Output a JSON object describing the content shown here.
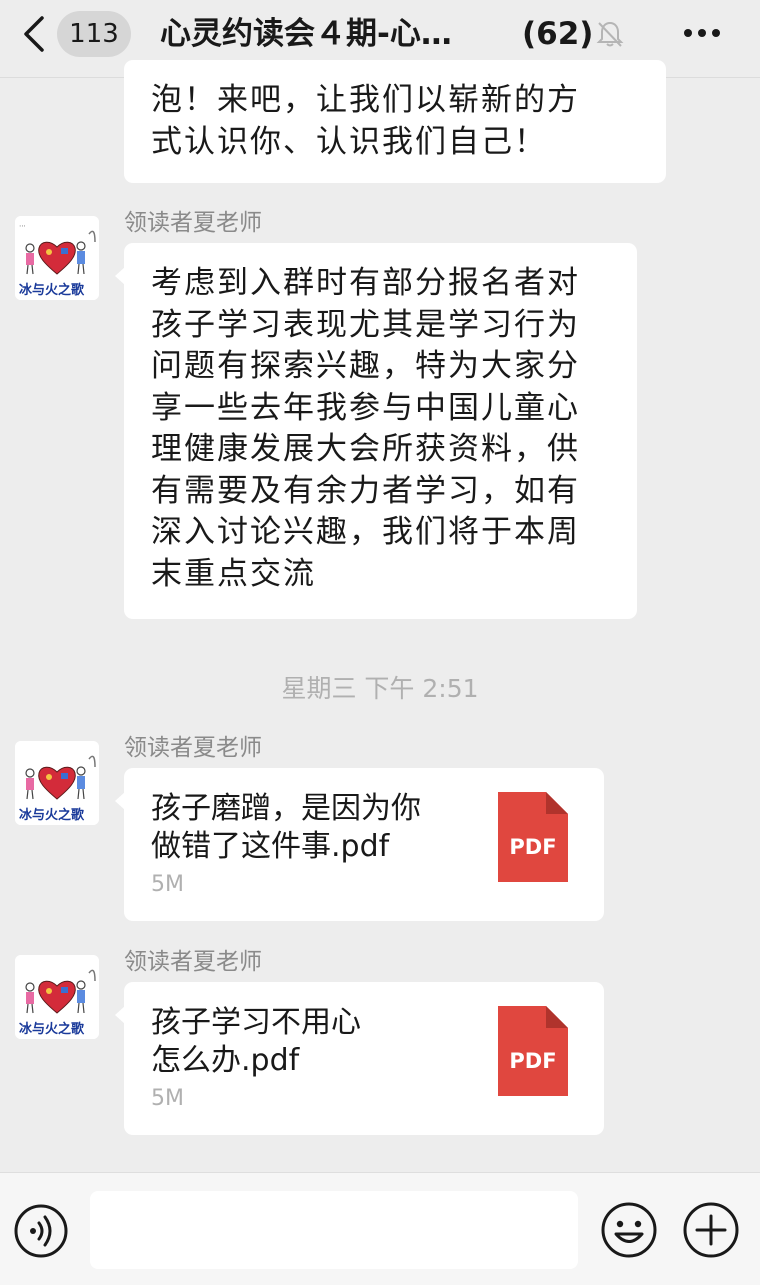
{
  "header": {
    "unread_count": "113",
    "title": "心灵约读会４期-心…",
    "member_count": "(62)"
  },
  "messages": [
    {
      "text": "泡！来吧，让我们以崭新的方\n式认识你、认识我们自己！"
    },
    {
      "sender": "领读者夏老师",
      "text": "考虑到入群时有部分报名者对\n孩子学习表现尤其是学习行为\n问题有探索兴趣，特为大家分\n享一些去年我参与中国儿童心\n理健康发展大会所获资料，供\n有需要及有余力者学习，如有\n深入讨论兴趣，我们将于本周\n末重点交流"
    }
  ],
  "timestamp": "星期三 下午 2:51",
  "files": [
    {
      "sender": "领读者夏老师",
      "name": "孩子磨蹭，是因为你\n做错了这件事.pdf",
      "size": "5M",
      "icon_label": "PDF"
    },
    {
      "sender": "领读者夏老师",
      "name": "孩子学习不用心\n怎么办.pdf",
      "size": "5M",
      "icon_label": "PDF"
    }
  ],
  "avatar": {
    "caption": "冰与火之歌"
  },
  "colors": {
    "background": "#ededed",
    "bubble": "#ffffff",
    "pdf_red": "#e0473f",
    "secondary_text": "#8a8a8a"
  },
  "icons": [
    "back-arrow-icon",
    "bell-muted-icon",
    "more-icon",
    "pdf-file-icon",
    "voice-icon",
    "emoji-icon",
    "plus-icon"
  ]
}
